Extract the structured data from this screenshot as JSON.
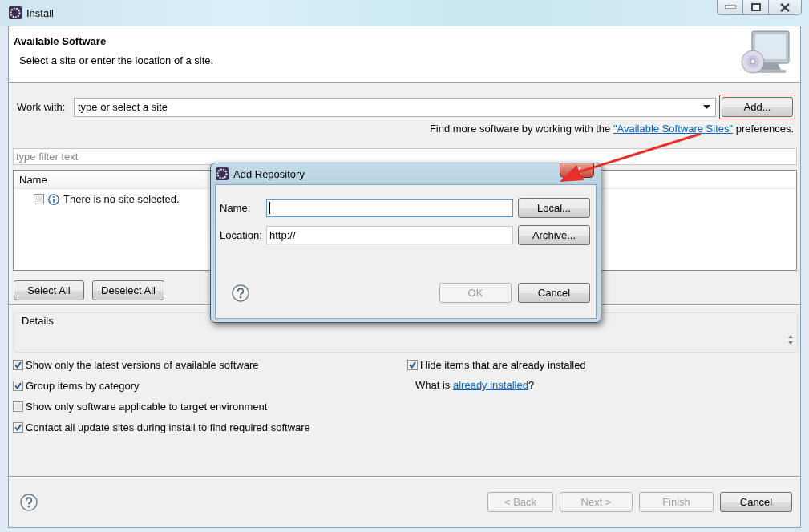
{
  "window": {
    "title": "Install"
  },
  "header": {
    "title": "Available Software",
    "description": "Select a site or enter the location of a site."
  },
  "work_with": {
    "label": "Work with:",
    "placeholder": "type or select a site",
    "button": "Add...",
    "highlighted": true
  },
  "more_software": {
    "before": "Find more software by working with the ",
    "link": "\"Available Software Sites\"",
    "after": " preferences."
  },
  "filter": {
    "placeholder": "type filter text"
  },
  "tree": {
    "columns": [
      "Name"
    ],
    "rows": [
      {
        "label": "There is no site selected.",
        "checked": false
      }
    ]
  },
  "selection_buttons": [
    "Select All",
    "Deselect All"
  ],
  "details": {
    "title": "Details"
  },
  "options": [
    {
      "label": "Show only the latest versions of available software",
      "checked": true
    },
    {
      "label": "Group items by category",
      "checked": true
    },
    {
      "label": "Show only software applicable to target environment",
      "checked": false
    },
    {
      "label": "Contact all update sites during install to find required software",
      "checked": true
    }
  ],
  "right_options": [
    {
      "label": "Hide items that are already installed",
      "checked": true
    }
  ],
  "installed_note": {
    "before": "What is ",
    "link": "already installed",
    "after": "?"
  },
  "footer_buttons": [
    {
      "label": "< Back",
      "disabled": true
    },
    {
      "label": "Next >",
      "disabled": true
    },
    {
      "label": "Finish",
      "disabled": true
    },
    {
      "label": "Cancel",
      "disabled": false
    }
  ],
  "dialog": {
    "title": "Add Repository",
    "fields": [
      {
        "label": "Name:",
        "focused": true,
        "button": "Local..."
      },
      {
        "label": "Location:",
        "value": "http://",
        "focused": false,
        "button": "Archive..."
      }
    ],
    "buttons": [
      {
        "label": "OK",
        "disabled": true
      },
      {
        "label": "Cancel",
        "disabled": false
      }
    ]
  }
}
